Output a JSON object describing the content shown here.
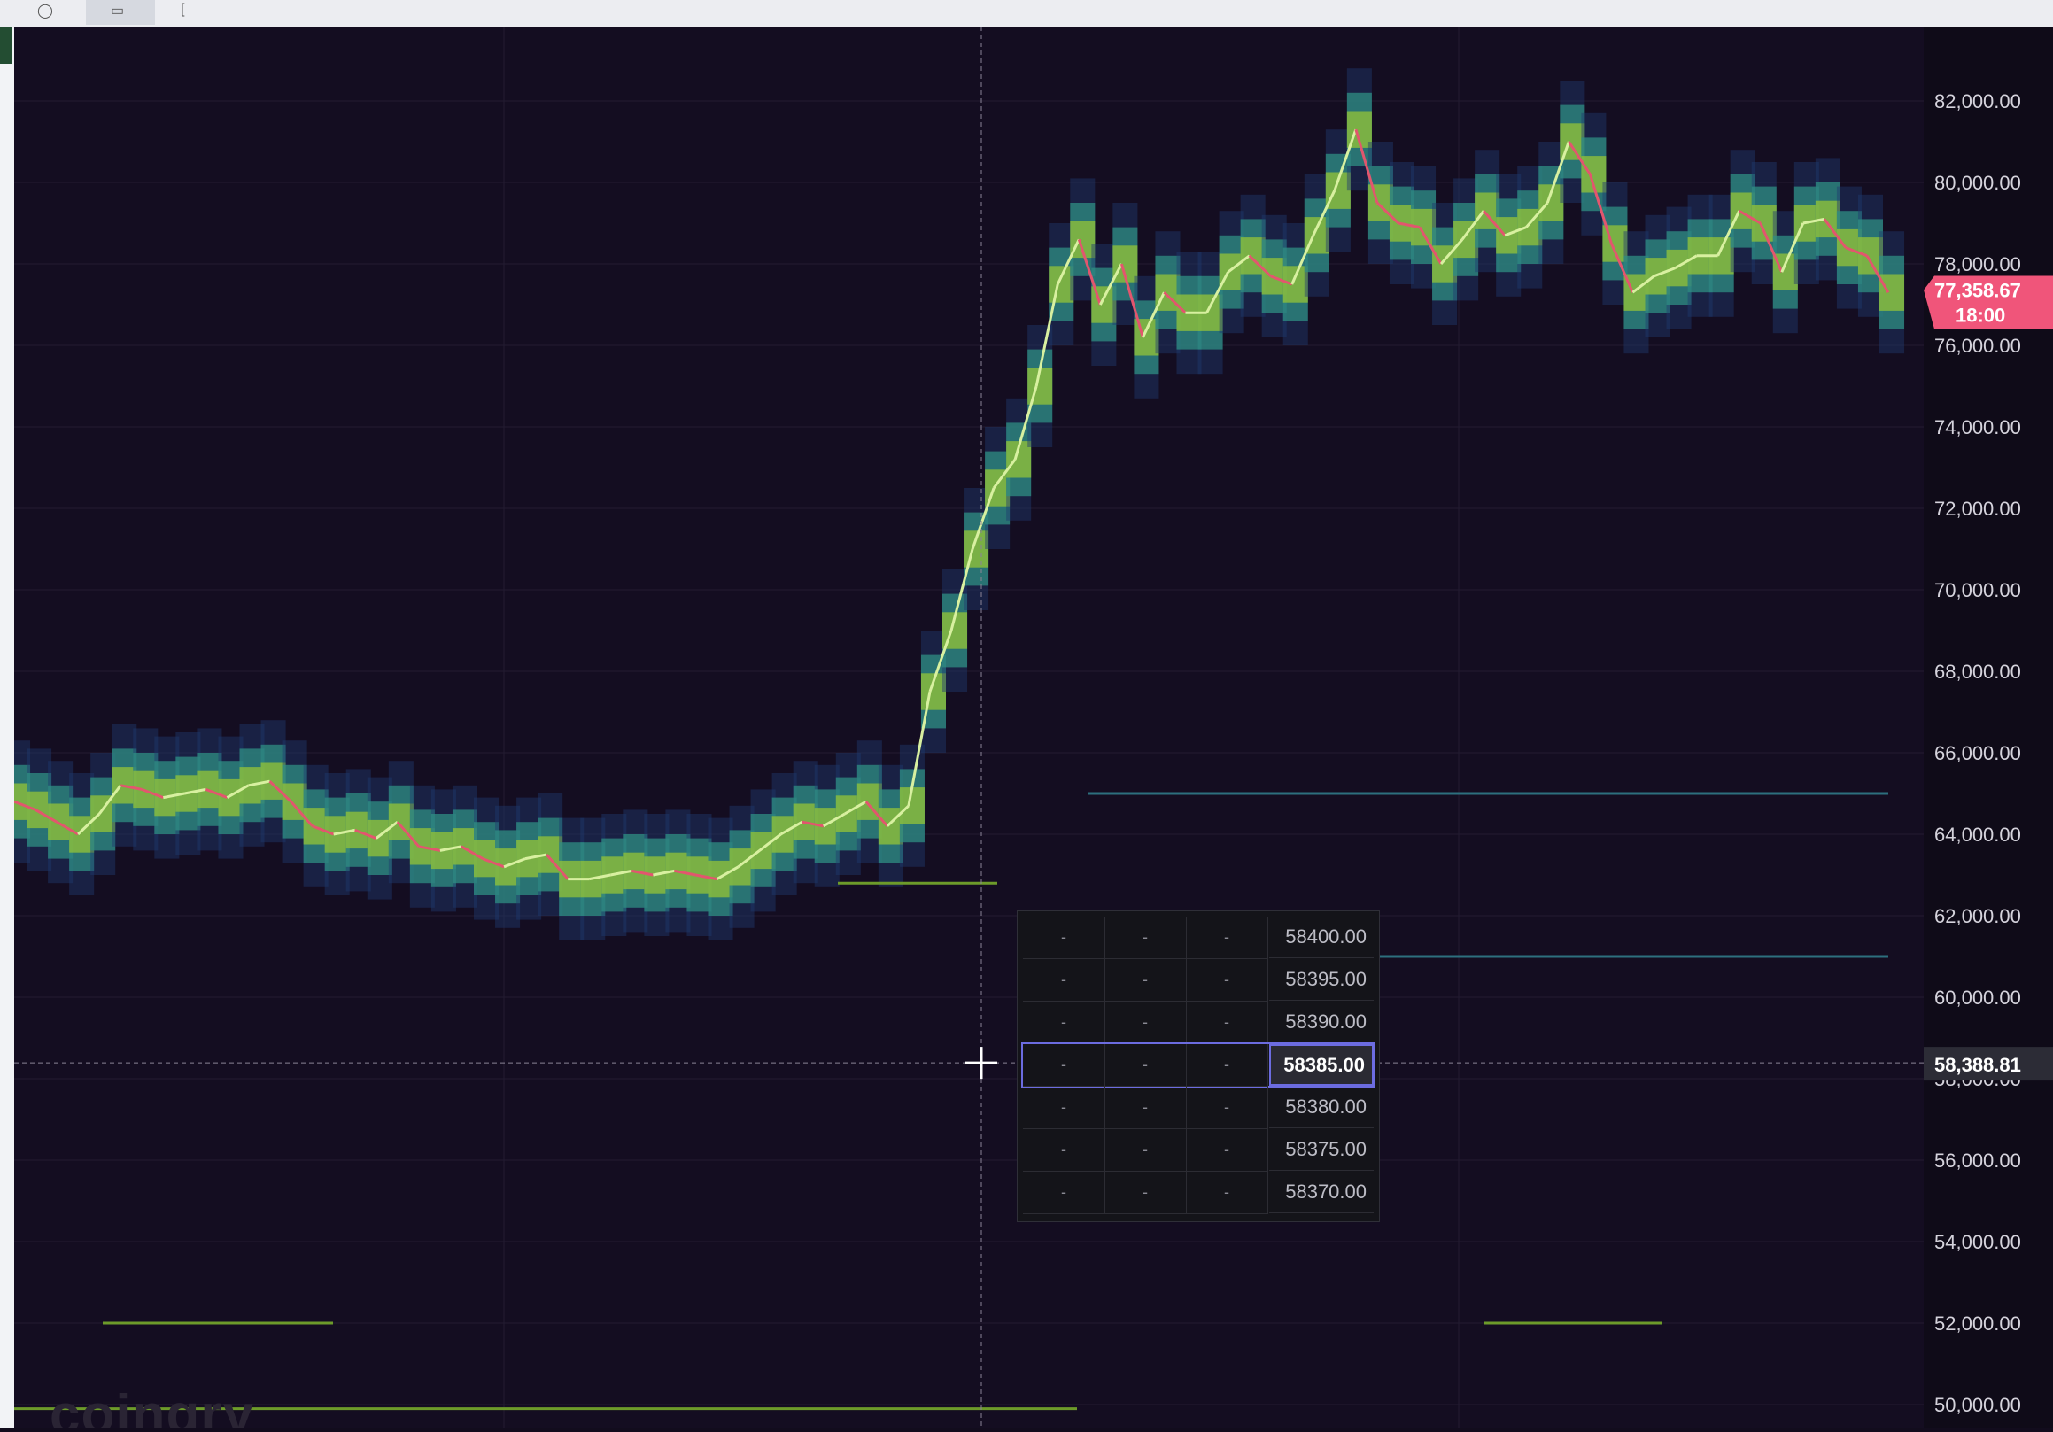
{
  "toolbar": {
    "icons": [
      "info-icon",
      "layout-icon",
      "bracket-icon"
    ]
  },
  "brand": {
    "watermark": "coingry"
  },
  "chart_data": {
    "type": "heatmap",
    "title": "",
    "xlabel": "",
    "ylabel": "",
    "ylim": [
      49000,
      84000
    ],
    "y_ticks": [
      "50,000.00",
      "52,000.00",
      "54,000.00",
      "56,000.00",
      "58,000.00",
      "60,000.00",
      "62,000.00",
      "64,000.00",
      "66,000.00",
      "68,000.00",
      "70,000.00",
      "72,000.00",
      "74,000.00",
      "76,000.00",
      "78,000.00",
      "80,000.00",
      "82,000.00"
    ],
    "last_price": {
      "value": "77,358.67",
      "countdown": "18:00",
      "color": "#f0557a"
    },
    "crosshair_price": "58,388.81",
    "series": [
      {
        "values": [
          64800,
          64600,
          64300,
          64000,
          64500,
          65200,
          65100,
          64900,
          65000,
          65100,
          64900,
          65200,
          65300,
          64800,
          64200,
          64000,
          64100,
          63900,
          64300,
          63700,
          63600,
          63700,
          63400,
          63200,
          63400,
          63500,
          62900,
          62900,
          63000,
          63100,
          63000,
          63100,
          63000,
          62900,
          63200,
          63600,
          64000,
          64300,
          64200,
          64500,
          64800,
          64200,
          64700,
          67500,
          69000,
          71000,
          72500,
          73200,
          75000,
          77500,
          78600,
          77000,
          78000,
          76200,
          77300,
          76800,
          76800,
          77800,
          78200,
          77700,
          77500,
          78700,
          79800,
          81300,
          79500,
          79000,
          78900,
          78000,
          78600,
          79300,
          78700,
          78900,
          79500,
          81000,
          80200,
          78500,
          77300,
          77700,
          77900,
          78200,
          78200,
          79300,
          79000,
          77800,
          79000,
          79100,
          78400,
          78200,
          77300
        ]
      }
    ],
    "liquidity_colors": {
      "low": "#1f3a6e",
      "mid": "#2f8f83",
      "high": "#8fbf3a",
      "candle_up": "#d8f0a0",
      "candle_down": "#e2566e"
    }
  },
  "orderbook": {
    "rows": [
      {
        "c1": "-",
        "c2": "-",
        "c3": "-",
        "price": "58400.00",
        "selected": false
      },
      {
        "c1": "-",
        "c2": "-",
        "c3": "-",
        "price": "58395.00",
        "selected": false
      },
      {
        "c1": "-",
        "c2": "-",
        "c3": "-",
        "price": "58390.00",
        "selected": false
      },
      {
        "c1": "-",
        "c2": "-",
        "c3": "-",
        "price": "58385.00",
        "selected": true
      },
      {
        "c1": "-",
        "c2": "-",
        "c3": "-",
        "price": "58380.00",
        "selected": false
      },
      {
        "c1": "-",
        "c2": "-",
        "c3": "-",
        "price": "58375.00",
        "selected": false
      },
      {
        "c1": "-",
        "c2": "-",
        "c3": "-",
        "price": "58370.00",
        "selected": false
      }
    ]
  }
}
